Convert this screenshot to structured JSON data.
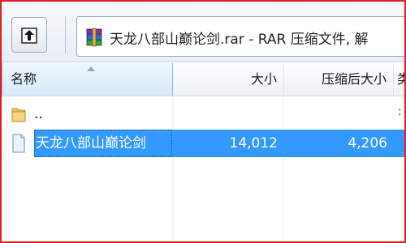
{
  "toolbar": {
    "up_icon": "up-folder-icon",
    "address_text": "天龙八部山巅论剑.rar - RAR 压缩文件, 解"
  },
  "columns": {
    "name": "名称",
    "size": "大小",
    "packed": "压缩后大小",
    "extra": "类"
  },
  "rows": [
    {
      "name": "..",
      "size": "",
      "packed": "",
      "icon": "folder-icon"
    },
    {
      "name": "天龙八部山巅论剑",
      "size": "14,012",
      "packed": "4,206",
      "icon": "file-icon",
      "selected": true
    }
  ],
  "colors": {
    "selection": "#3399ff",
    "frame_border": "#e02020"
  }
}
